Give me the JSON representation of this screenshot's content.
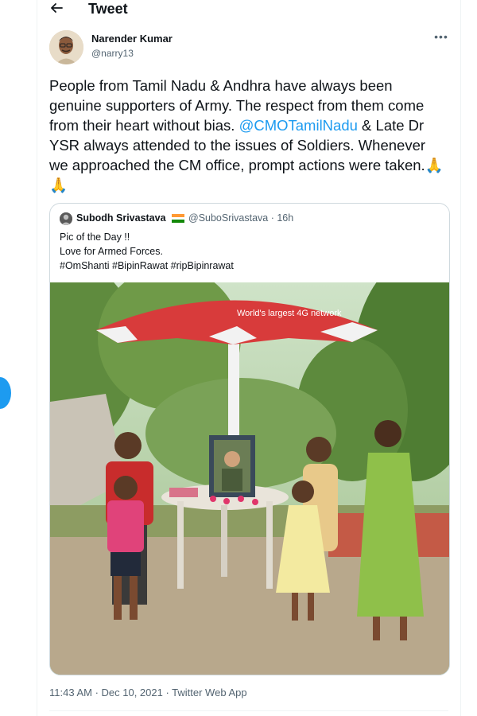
{
  "header": {
    "title": "Tweet",
    "back_icon": "arrow-left-icon"
  },
  "tweet": {
    "author_name": "Narender Kumar",
    "author_handle": "@narry13",
    "more_icon": "more-horizontal-icon",
    "text_part1": "People from Tamil Nadu & Andhra have always been genuine supporters of Army. The respect from them come from their heart without bias. ",
    "mention": "@CMOTamilNadu",
    "text_part2": " & Late Dr YSR always attended to the issues of Soldiers. Whenever we approached the CM office, prompt actions were taken.",
    "emoji": "🙏🙏",
    "timestamp": "11:43 AM · Dec 10, 2021 · Twitter Web App"
  },
  "quote": {
    "author_name": "Subodh Srivastava",
    "flag_icon": "india-flag-icon",
    "author_handle": "@SuboSrivastava",
    "time": "16h",
    "line1": "Pic of the Day !!",
    "line2": "Love for Armed Forces.",
    "line3": "#OmShanti #BipinRawat #ripBipinrawat",
    "image_text": "World's largest 4G network"
  },
  "colors": {
    "accent": "#1d9bf0",
    "text_primary": "#0f1419",
    "text_secondary": "#536471",
    "border": "#cfd9de"
  }
}
